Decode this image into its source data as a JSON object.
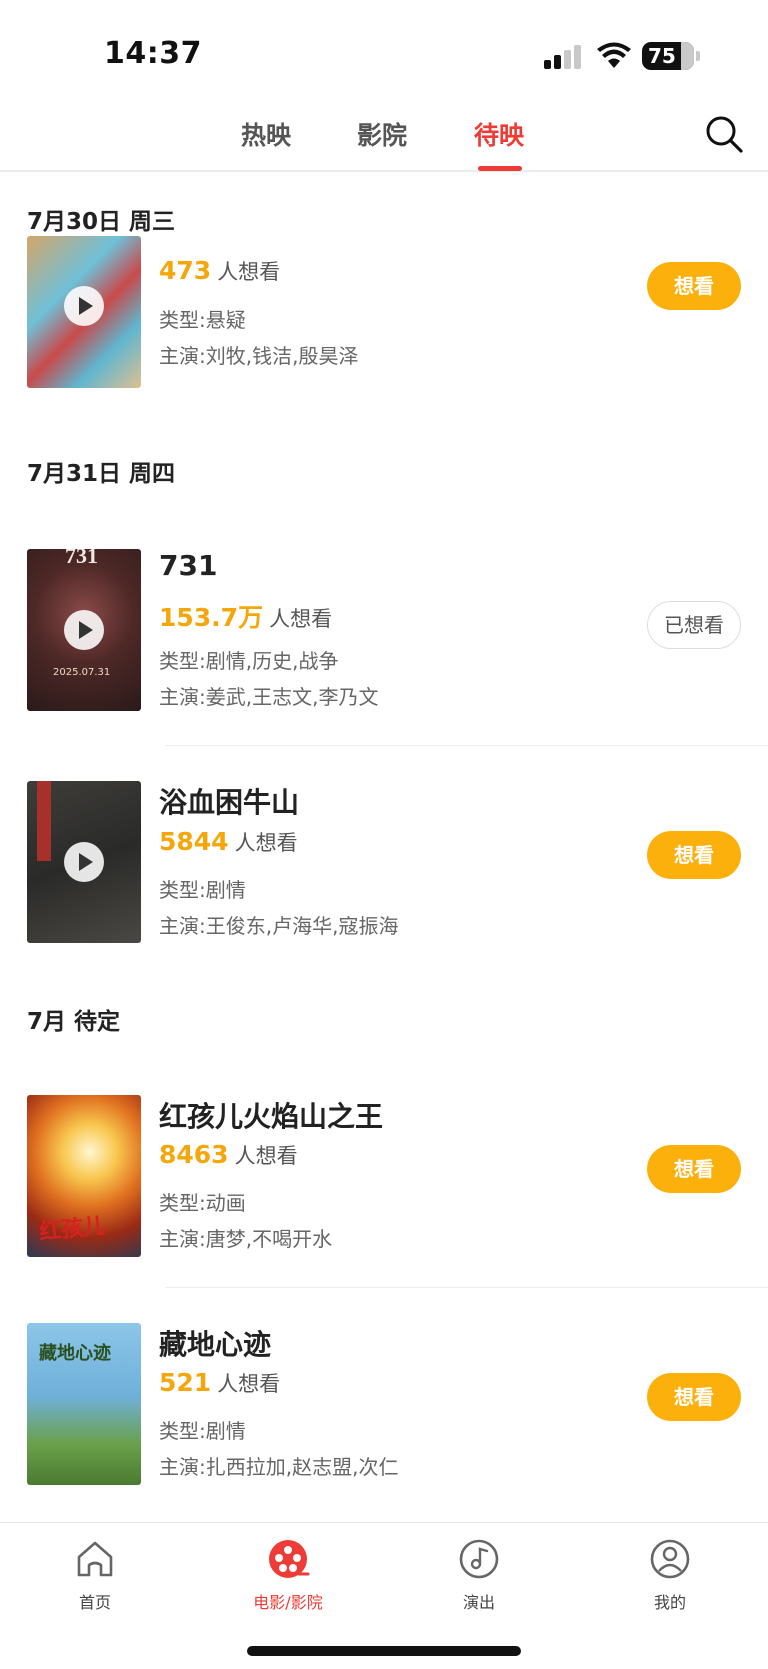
{
  "status_bar": {
    "time": "14:37",
    "battery": "75",
    "battery_level_pct": 75
  },
  "tabs": [
    {
      "label": "热映",
      "active": false
    },
    {
      "label": "影院",
      "active": false
    },
    {
      "label": "待映",
      "active": true
    }
  ],
  "sections": [
    {
      "date": "7月30日 周三",
      "movies": [
        {
          "title": "",
          "want_count": "473",
          "want_suffix": "人想看",
          "genre": "类型:悬疑",
          "cast": "主演:刘牧,钱洁,殷昊泽",
          "button": "想看",
          "wanted": false
        }
      ]
    },
    {
      "date": "7月31日 周四",
      "movies": [
        {
          "title": "731",
          "want_count": "153.7万",
          "want_suffix": "人想看",
          "genre": "类型:剧情,历史,战争",
          "cast": "主演:姜武,王志文,李乃文",
          "button": "已想看",
          "wanted": true
        },
        {
          "title": "浴血困牛山",
          "want_count": "5844",
          "want_suffix": "人想看",
          "genre": "类型:剧情",
          "cast": "主演:王俊东,卢海华,寇振海",
          "button": "想看",
          "wanted": false
        }
      ]
    },
    {
      "date": "7月 待定",
      "movies": [
        {
          "title": "红孩儿火焰山之王",
          "want_count": "8463",
          "want_suffix": "人想看",
          "genre": "类型:动画",
          "cast": "主演:唐梦,不喝开水",
          "button": "想看",
          "wanted": false
        },
        {
          "title": "藏地心迹",
          "want_count": "521",
          "want_suffix": "人想看",
          "genre": "类型:剧情",
          "cast": "主演:扎西拉加,赵志盟,次仁",
          "button": "想看",
          "wanted": false
        }
      ]
    }
  ],
  "poster_texts": {
    "p731": "731",
    "p731_date": "2025.07.31",
    "red_boy": "红孩儿",
    "tibet": "藏地心迹"
  },
  "bottom_nav": [
    {
      "label": "首页",
      "icon": "home-icon",
      "active": false
    },
    {
      "label": "电影/影院",
      "icon": "film-reel-icon",
      "active": true
    },
    {
      "label": "演出",
      "icon": "music-disc-icon",
      "active": false
    },
    {
      "label": "我的",
      "icon": "profile-icon",
      "active": false
    }
  ],
  "colors": {
    "accent": "#ee3b36",
    "want_button": "#fcb00c",
    "want_count": "#f5a60a"
  }
}
